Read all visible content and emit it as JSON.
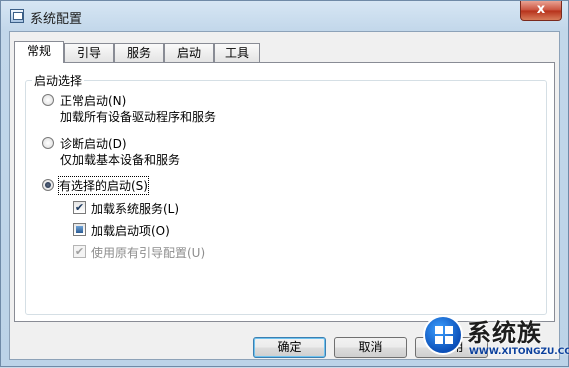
{
  "window": {
    "title": "系统配置",
    "close_label": "x"
  },
  "tabs": [
    {
      "label": "常规",
      "active": true
    },
    {
      "label": "引导",
      "active": false
    },
    {
      "label": "服务",
      "active": false
    },
    {
      "label": "启动",
      "active": false
    },
    {
      "label": "工具",
      "active": false
    }
  ],
  "startup": {
    "group_title": "启动选择",
    "options": [
      {
        "label": "正常启动(N)",
        "desc": "加载所有设备驱动程序和服务",
        "checked": false
      },
      {
        "label": "诊断启动(D)",
        "desc": "仅加载基本设备和服务",
        "checked": false
      },
      {
        "label": "有选择的启动(S)",
        "checked": true
      }
    ],
    "sub_options": [
      {
        "label": "加载系统服务(L)",
        "state": "checked",
        "enabled": true
      },
      {
        "label": "加载启动项(O)",
        "state": "indeterminate",
        "enabled": true
      },
      {
        "label": "使用原有引导配置(U)",
        "state": "checked",
        "enabled": false
      }
    ]
  },
  "buttons": {
    "ok": "确定",
    "cancel": "取消",
    "apply": "应用"
  },
  "watermark": {
    "brand": "系统族",
    "url": "WWW.XITONGZU.COM"
  }
}
